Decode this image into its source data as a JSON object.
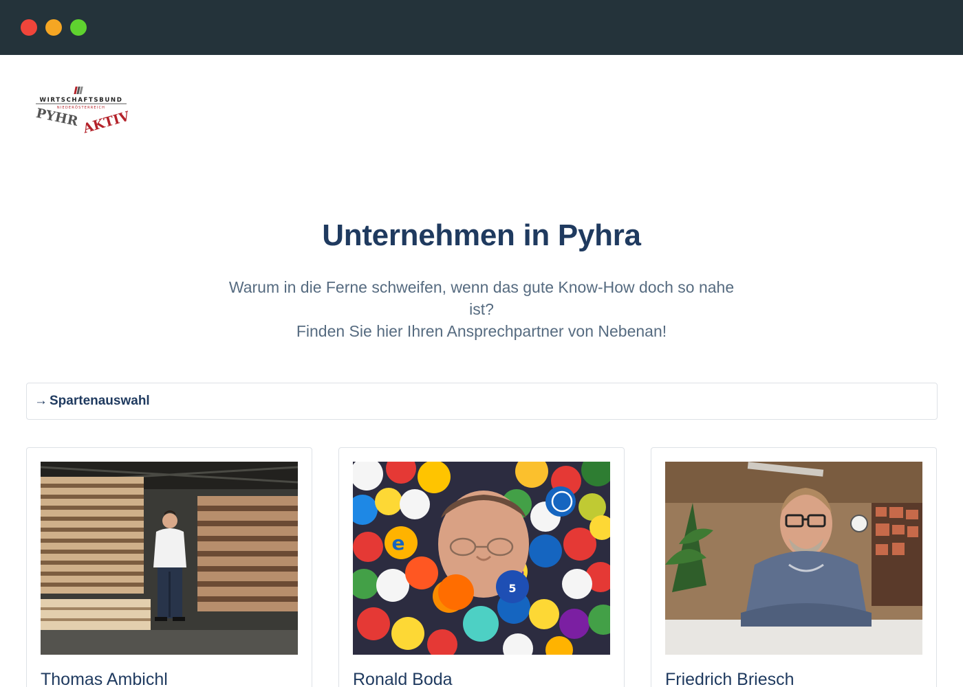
{
  "window": {
    "controls": [
      "close",
      "minimize",
      "maximize"
    ],
    "colors": {
      "titlebar": "#24333a",
      "close": "#f0453a",
      "minimize": "#f5a623",
      "maximize": "#5fd22f"
    }
  },
  "logo": {
    "line1": "WIRTSCHAFTSBUND",
    "line2": "NIEDERÖSTERREICH",
    "word_left": "PYHR",
    "word_right": "AKTIV"
  },
  "hero": {
    "title": "Unternehmen in Pyhra",
    "subtitle_line1": "Warum in die Ferne schweifen, wenn das gute Know-How doch so nahe",
    "subtitle_line2": "ist?",
    "subtitle_line3": "Finden Sie hier Ihren Ansprechpartner von Nebenan!"
  },
  "filter": {
    "icon": "arrow-right-icon",
    "label": "Spartenauswahl"
  },
  "cards": [
    {
      "name": "Thomas Ambichl",
      "photo": "person-with-lumber-stacks"
    },
    {
      "name": "Ronald Boda",
      "photo": "face-in-ball-pit"
    },
    {
      "name": "Friedrich Briesch",
      "photo": "person-at-office-desk"
    }
  ],
  "colors": {
    "heading": "#1f3a5f",
    "muted": "#566b80",
    "border": "#dde1e6",
    "logo_red": "#b4222a"
  }
}
